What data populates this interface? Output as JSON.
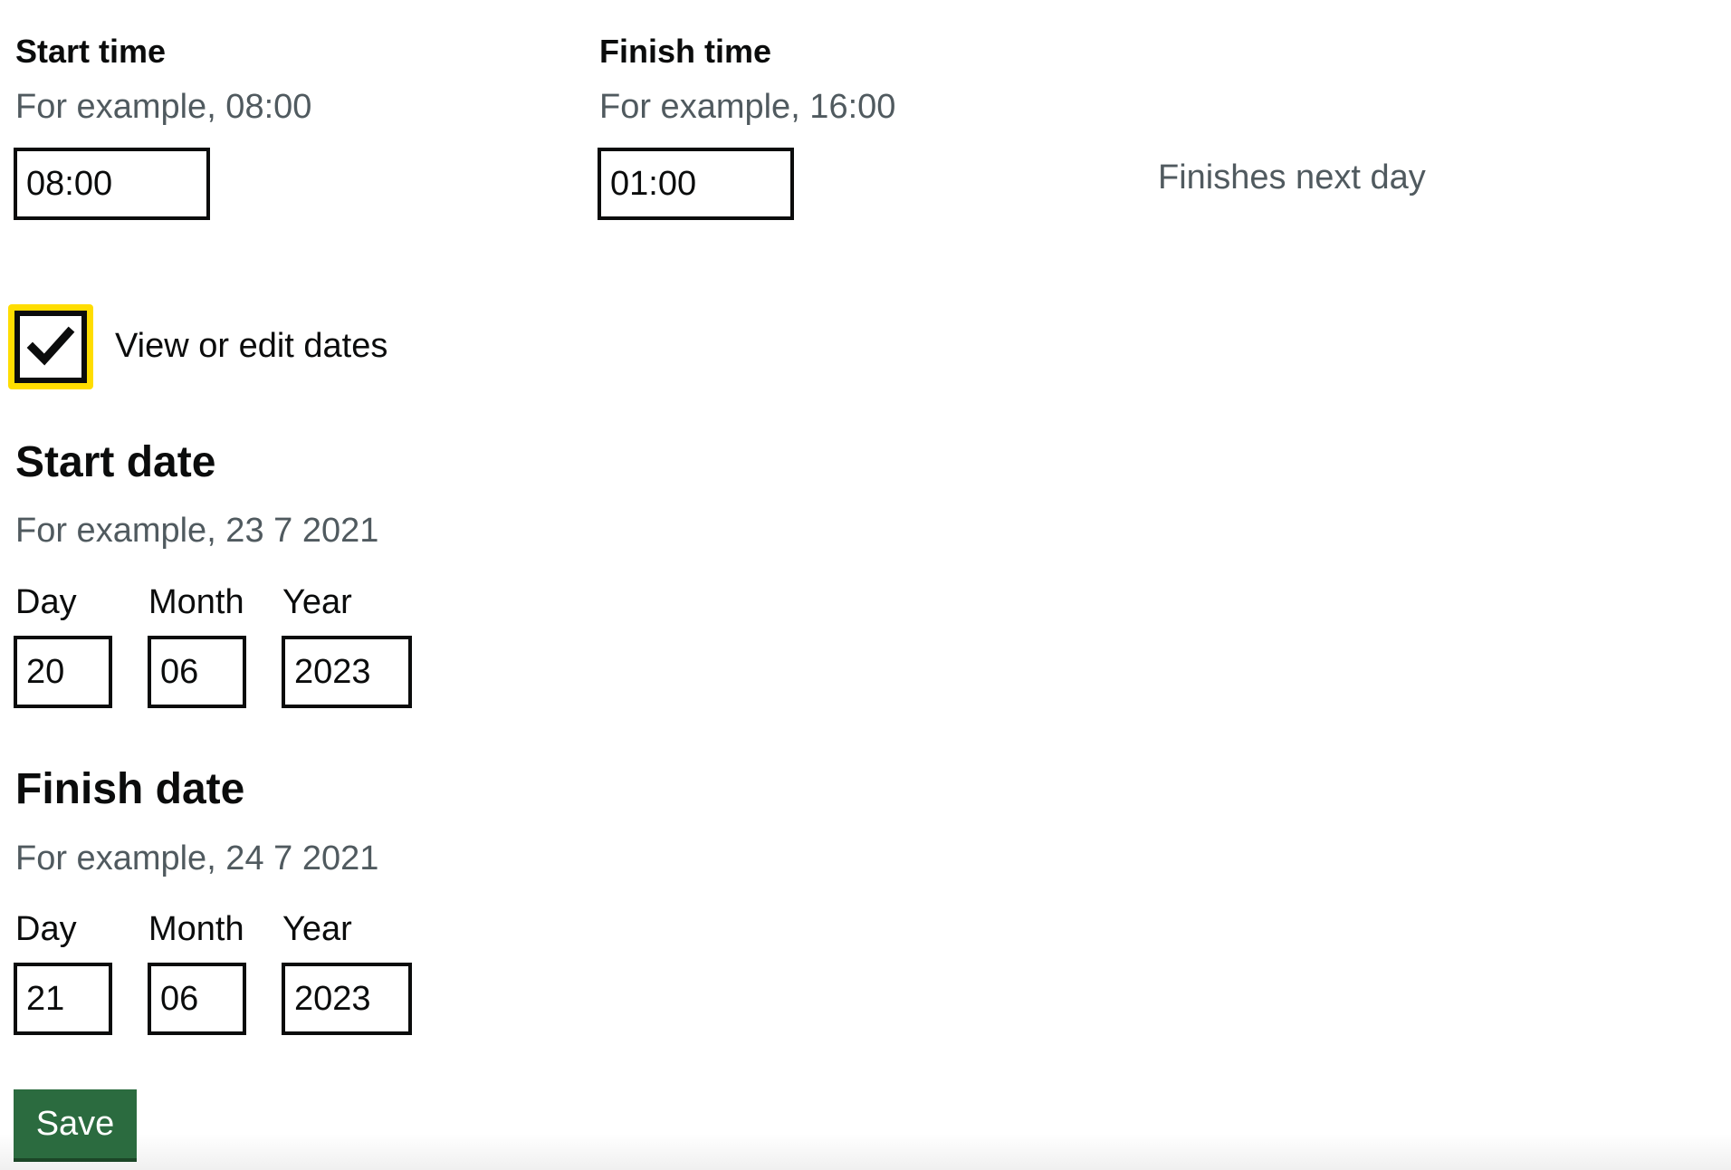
{
  "start_time": {
    "label": "Start time",
    "hint": "For example, 08:00",
    "value": "08:00"
  },
  "finish_time": {
    "label": "Finish time",
    "hint": "For example, 16:00",
    "value": "01:00",
    "note": "Finishes next day"
  },
  "view_dates": {
    "label": "View or edit dates",
    "checked": true
  },
  "start_date": {
    "heading": "Start date",
    "hint": "For example, 23 7 2021",
    "day_label": "Day",
    "month_label": "Month",
    "year_label": "Year",
    "day": "20",
    "month": "06",
    "year": "2023"
  },
  "finish_date": {
    "heading": "Finish date",
    "hint": "For example, 24 7 2021",
    "day_label": "Day",
    "month_label": "Month",
    "year_label": "Year",
    "day": "21",
    "month": "06",
    "year": "2023"
  },
  "actions": {
    "save_label": "Save"
  },
  "colors": {
    "text": "#0b0c0c",
    "hint": "#505a5f",
    "focus": "#ffdd00",
    "button": "#2b6b3f"
  }
}
